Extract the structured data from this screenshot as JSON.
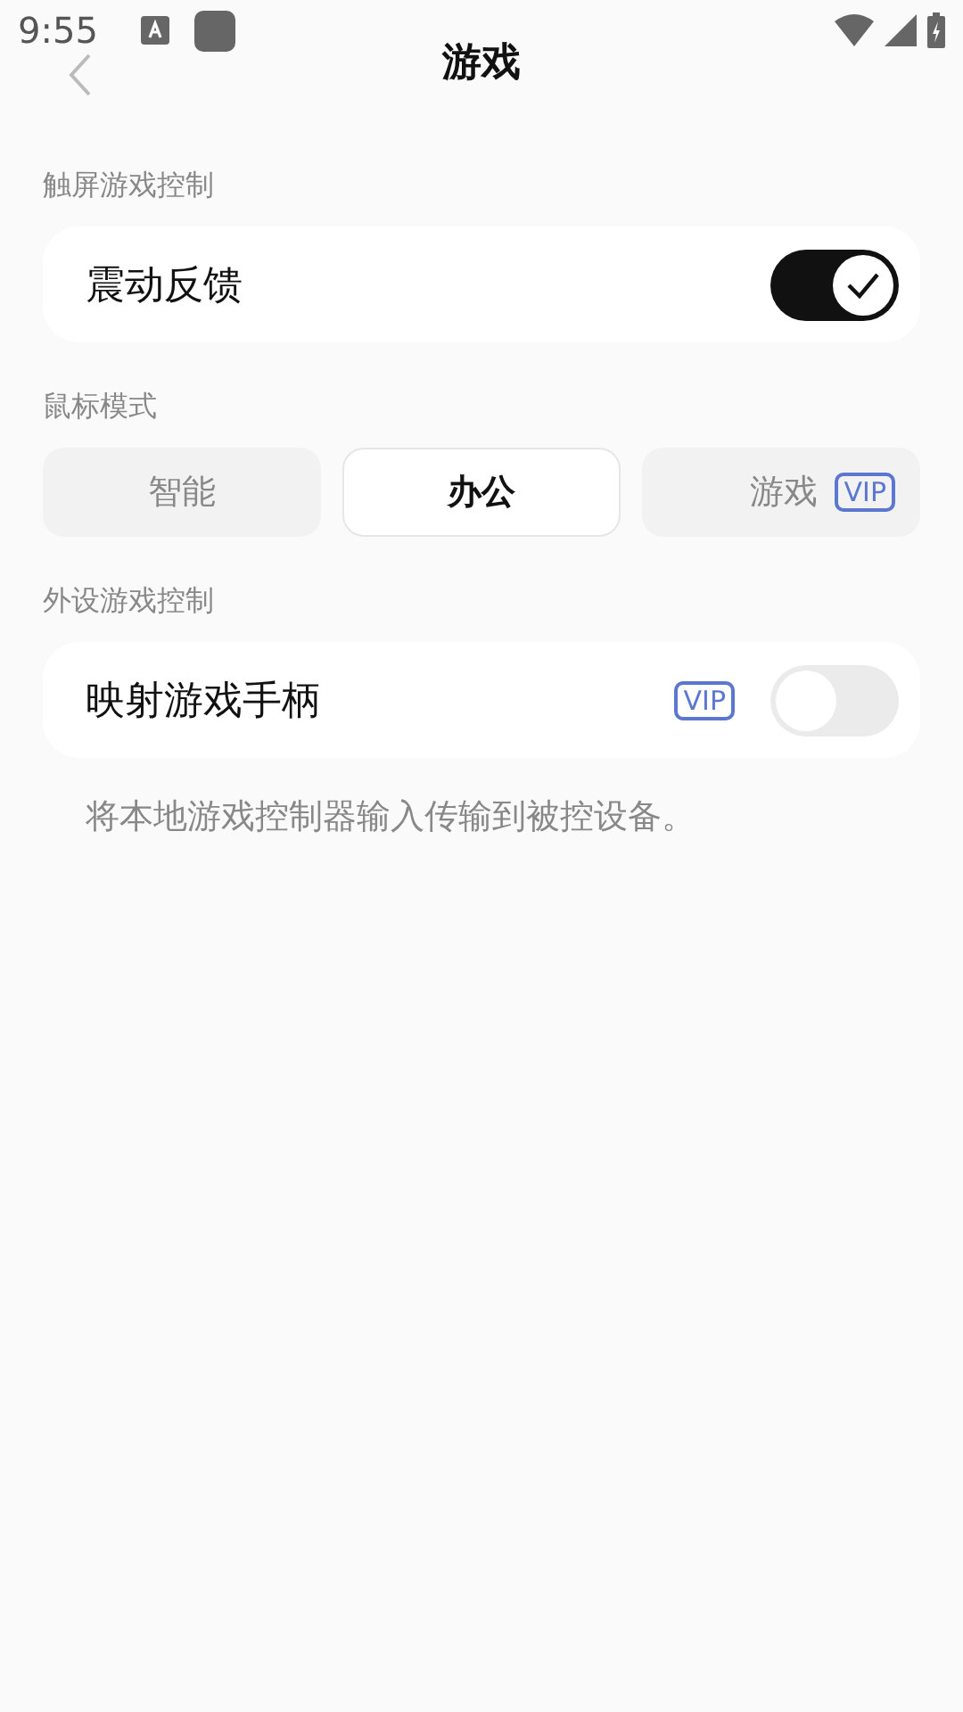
{
  "status_bar": {
    "time": "9:55"
  },
  "header": {
    "title": "游戏"
  },
  "sections": [
    {
      "label": "触屏游戏控制",
      "kind": "card",
      "rows": [
        {
          "label": "震动反馈",
          "on": true
        }
      ]
    },
    {
      "label": "鼠标模式",
      "kind": "segments",
      "segments": [
        {
          "label": "智能",
          "selected": false
        },
        {
          "label": "办公",
          "selected": true
        },
        {
          "label": "游戏",
          "vip_label": "VIP",
          "selected": false
        }
      ]
    },
    {
      "label": "外设游戏控制",
      "kind": "card",
      "rows": [
        {
          "label": "映射游戏手柄",
          "vip_label": "VIP",
          "on": false
        }
      ],
      "note": "将本地游戏控制器输入传输到被控设备。"
    }
  ]
}
